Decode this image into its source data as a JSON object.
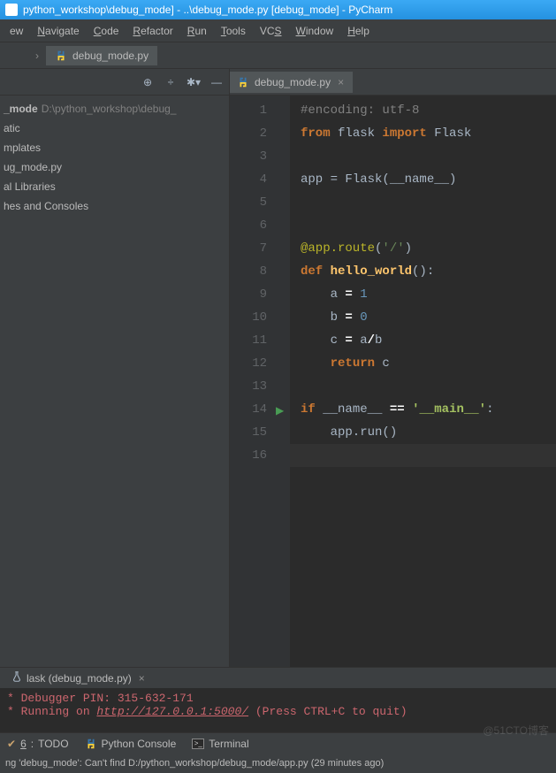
{
  "title": "python_workshop\\debug_mode] - ..\\debug_mode.py [debug_mode] - PyCharm",
  "menu": [
    "ew",
    "Navigate",
    "Code",
    "Refactor",
    "Run",
    "Tools",
    "VCS",
    "Window",
    "Help"
  ],
  "menu_mnemonic": [
    "",
    "N",
    "C",
    "R",
    "R",
    "T",
    "S",
    "W",
    "H"
  ],
  "breadcrumb_tab": "debug_mode.py",
  "sidebar": {
    "project_name": "_mode",
    "project_path": "D:\\python_workshop\\debug_",
    "items": [
      "atic",
      "mplates",
      "ug_mode.py",
      "al Libraries",
      "hes and Consoles"
    ]
  },
  "editor": {
    "tab_name": "debug_mode.py",
    "lines": [
      {
        "n": 1,
        "tokens": [
          [
            "comment",
            "#encoding: utf-8"
          ]
        ]
      },
      {
        "n": 2,
        "tokens": [
          [
            "kw-b",
            "from"
          ],
          [
            "name",
            " flask "
          ],
          [
            "kw-b",
            "import"
          ],
          [
            "name",
            " Flask"
          ]
        ]
      },
      {
        "n": 3,
        "tokens": []
      },
      {
        "n": 4,
        "tokens": [
          [
            "name",
            "app "
          ],
          [
            "op",
            "= "
          ],
          [
            "name",
            "Flask(__name__)"
          ]
        ]
      },
      {
        "n": 5,
        "tokens": []
      },
      {
        "n": 6,
        "tokens": []
      },
      {
        "n": 7,
        "tokens": [
          [
            "dec",
            "@app.route"
          ],
          [
            "name",
            "("
          ],
          [
            "str",
            "'/'"
          ],
          [
            "name",
            ")"
          ]
        ]
      },
      {
        "n": 8,
        "tokens": [
          [
            "kw-b",
            "def "
          ],
          [
            "def-name",
            "hello_world"
          ],
          [
            "name",
            "():"
          ]
        ]
      },
      {
        "n": 9,
        "tokens": [
          [
            "name",
            "    a "
          ],
          [
            "white",
            "= "
          ],
          [
            "num",
            "1"
          ]
        ]
      },
      {
        "n": 10,
        "tokens": [
          [
            "name",
            "    b "
          ],
          [
            "white",
            "= "
          ],
          [
            "num",
            "0"
          ]
        ]
      },
      {
        "n": 11,
        "tokens": [
          [
            "name",
            "    c "
          ],
          [
            "white",
            "= "
          ],
          [
            "name",
            "a"
          ],
          [
            "white",
            "/"
          ],
          [
            "name",
            "b"
          ]
        ]
      },
      {
        "n": 12,
        "tokens": [
          [
            "name",
            "    "
          ],
          [
            "kw-b",
            "return "
          ],
          [
            "name",
            "c"
          ]
        ]
      },
      {
        "n": 13,
        "tokens": []
      },
      {
        "n": 14,
        "tokens": [
          [
            "kw-b",
            "if "
          ],
          [
            "name",
            "__name__ "
          ],
          [
            "white",
            "== "
          ],
          [
            "str-b",
            "'__main__'"
          ],
          [
            "name",
            ":"
          ]
        ]
      },
      {
        "n": 15,
        "tokens": [
          [
            "name",
            "    app.run()"
          ]
        ]
      },
      {
        "n": 16,
        "tokens": [],
        "current": true
      }
    ]
  },
  "console": {
    "tab": "lask (debug_mode.py)",
    "line1_pre": " * Debugger PIN: 315-632-171",
    "line2_pre": " * Running on ",
    "line2_link": "http://127.0.0.1:5000/",
    "line2_post": " (Press CTRL+C to quit)"
  },
  "tool_windows": {
    "todo_num": "6",
    "todo": "TODO",
    "py_console": "Python Console",
    "terminal": "Terminal"
  },
  "status": "ng 'debug_mode': Can't find D:/python_workshop/debug_mode/app.py (29 minutes ago)",
  "watermark": "@51CTO博客"
}
